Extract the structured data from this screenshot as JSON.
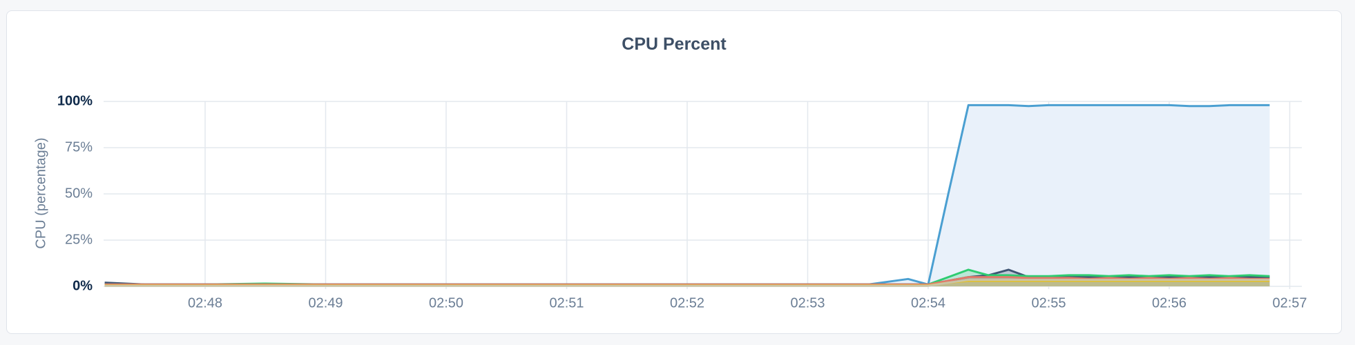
{
  "chart_data": {
    "type": "area",
    "title": "CPU Percent",
    "ylabel": "CPU (percentage)",
    "xlabel": "",
    "ylim": [
      0,
      100
    ],
    "y_ticks": [
      "0%",
      "25%",
      "50%",
      "75%",
      "100%"
    ],
    "x_tick_labels": [
      "02:48",
      "02:49",
      "02:50",
      "02:51",
      "02:52",
      "02:53",
      "02:54",
      "02:55",
      "02:56",
      "02:57"
    ],
    "x_range": [
      "02:47:10",
      "02:57:00"
    ],
    "grid": true,
    "x": [
      "02:47:10",
      "02:47:30",
      "02:48:00",
      "02:48:30",
      "02:49:00",
      "02:49:30",
      "02:50:00",
      "02:50:30",
      "02:51:00",
      "02:51:30",
      "02:52:00",
      "02:52:30",
      "02:53:00",
      "02:53:30",
      "02:53:50",
      "02:54:00",
      "02:54:10",
      "02:54:20",
      "02:54:30",
      "02:54:40",
      "02:54:50",
      "02:55:00",
      "02:55:10",
      "02:55:20",
      "02:55:30",
      "02:55:40",
      "02:55:50",
      "02:56:00",
      "02:56:10",
      "02:56:20",
      "02:56:30",
      "02:56:40",
      "02:56:50"
    ],
    "series": [
      {
        "color": "#4a9fd1",
        "fill": "#e9f1fa",
        "values": [
          1,
          1,
          1,
          1,
          1,
          1,
          1,
          1,
          1,
          1,
          1,
          1,
          1,
          1,
          4,
          1,
          50,
          98,
          98,
          98,
          97.5,
          98,
          98,
          98,
          98,
          98,
          98,
          98,
          97.5,
          97.5,
          98,
          98,
          98
        ]
      },
      {
        "color": "#3f5573",
        "values": [
          2,
          1,
          1,
          1,
          1,
          1,
          1,
          1,
          1,
          1,
          1,
          1,
          1,
          1,
          1,
          1,
          3,
          5,
          6,
          9,
          5,
          5,
          5,
          5,
          5,
          5,
          5,
          5,
          5,
          5,
          5,
          5,
          5
        ]
      },
      {
        "color": "#2ecc71",
        "values": [
          1,
          1,
          1,
          1.5,
          1,
          1,
          1,
          1,
          1,
          1,
          1,
          1,
          1,
          1,
          1,
          1,
          5,
          9,
          6,
          6,
          5.5,
          5.5,
          6,
          6,
          5.5,
          6,
          5.5,
          6,
          5.5,
          6,
          5.5,
          6,
          5.5
        ]
      },
      {
        "color": "#e07a6b",
        "values": [
          1,
          1,
          1,
          1,
          1,
          1,
          1,
          1,
          1,
          1,
          1,
          1,
          1,
          1,
          1,
          1,
          3,
          5,
          5,
          5,
          4.5,
          4.5,
          4.5,
          4,
          4.5,
          4,
          4.5,
          4,
          4.5,
          4,
          4.5,
          4,
          4
        ]
      },
      {
        "color": "#e8c21d",
        "values": [
          0.5,
          0.5,
          0.5,
          0.5,
          0.5,
          0.5,
          0.5,
          0.5,
          0.5,
          0.5,
          0.5,
          0.5,
          0.5,
          0.5,
          0.5,
          0.5,
          2,
          3,
          3,
          3,
          3,
          3,
          3,
          3,
          3,
          3,
          3,
          3,
          3,
          3,
          3,
          3,
          3
        ]
      },
      {
        "color": "#c9c4a6",
        "values": [
          0.3,
          0.3,
          0.3,
          0.3,
          0.3,
          0.3,
          0.3,
          0.3,
          0.3,
          0.3,
          0.3,
          0.3,
          0.3,
          0.3,
          0.3,
          0.3,
          2,
          3.5,
          3.5,
          3.5,
          3.5,
          3.5,
          3.5,
          3.5,
          3.5,
          3.5,
          3.5,
          3.5,
          3.5,
          3.5,
          3.5,
          3.5,
          3.5
        ]
      }
    ]
  }
}
